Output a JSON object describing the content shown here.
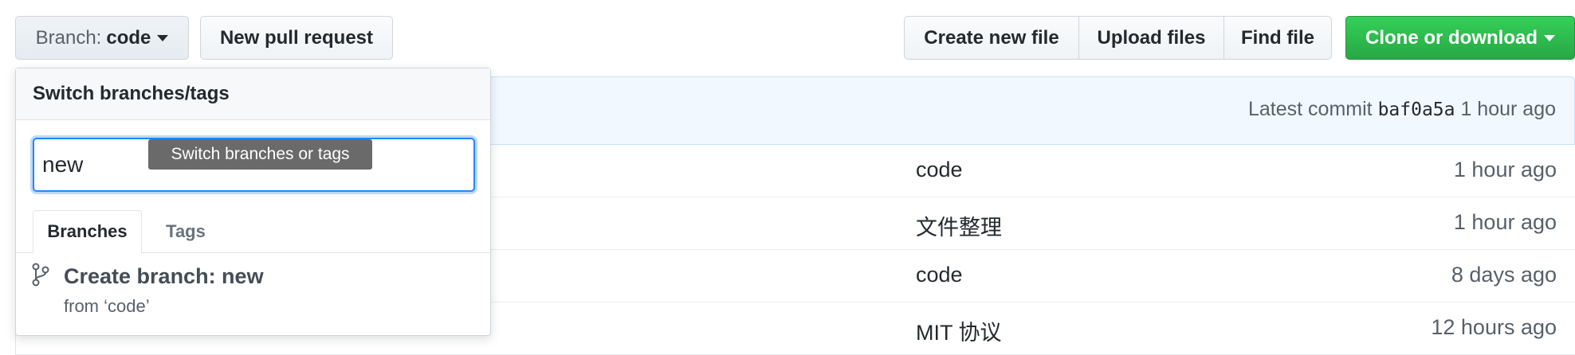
{
  "toolbar": {
    "branch_prefix": "Branch:",
    "branch_name": "code",
    "new_pull_request": "New pull request",
    "create_new_file": "Create new file",
    "upload_files": "Upload files",
    "find_file": "Find file",
    "clone_or_download": "Clone or download"
  },
  "commit_bar": {
    "label": "Latest commit",
    "hash": "baf0a5a",
    "time": "1 hour ago"
  },
  "file_rows": [
    {
      "message": "code",
      "age": "1 hour ago"
    },
    {
      "message": "文件整理",
      "age": "1 hour ago"
    },
    {
      "message": "code",
      "age": "8 days ago"
    },
    {
      "message": "MIT 协议",
      "age": "12 hours ago"
    }
  ],
  "dropdown": {
    "title": "Switch branches/tags",
    "filter_value": "new",
    "tooltip": "Switch branches or tags",
    "tabs": [
      {
        "label": "Branches"
      },
      {
        "label": "Tags"
      }
    ],
    "create_title": "Create branch: new",
    "create_sub": "from ‘code’"
  },
  "colors": {
    "accent": "#2188ff",
    "clone_button": "#2ea44f",
    "commit_bar_bg": "#f1f8ff"
  }
}
